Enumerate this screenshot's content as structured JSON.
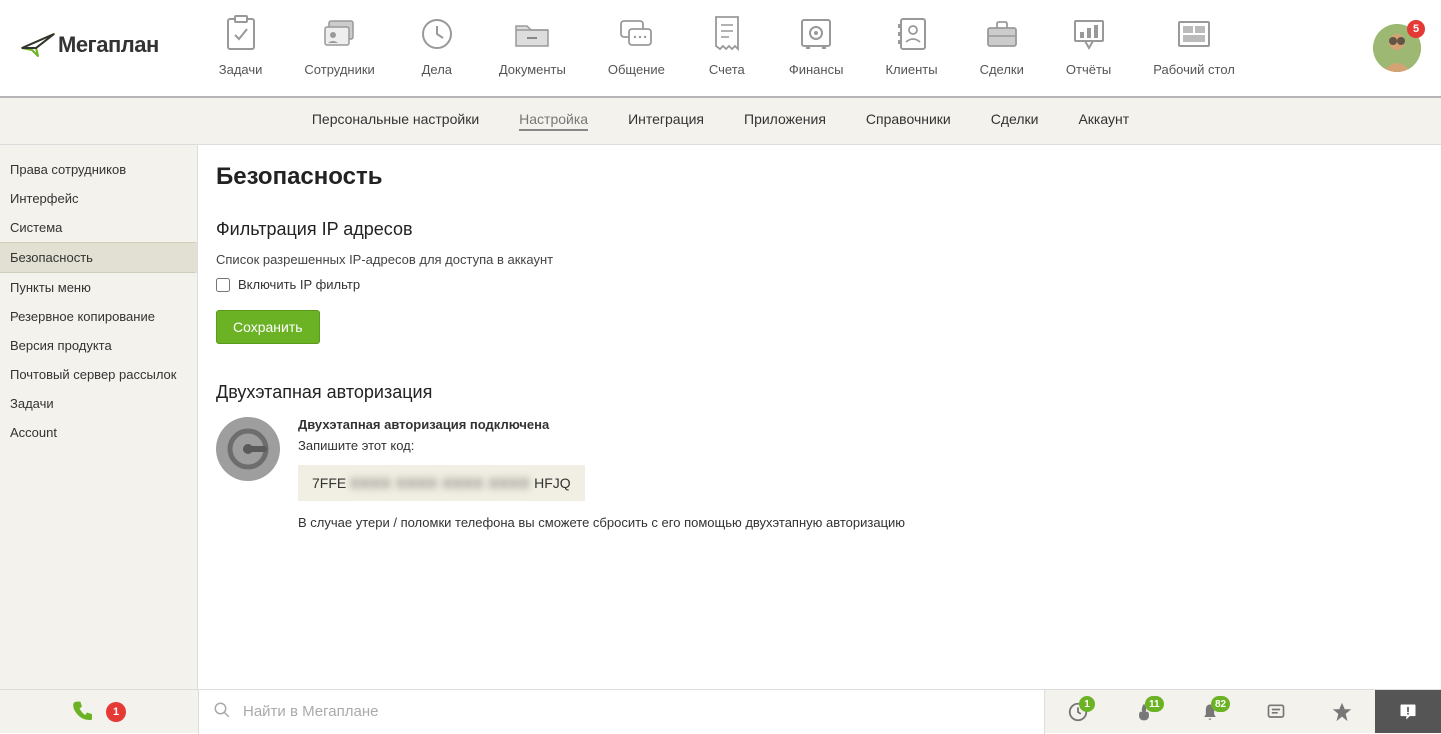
{
  "logo": {
    "text": "Мегаплан"
  },
  "topnav": [
    {
      "label": "Задачи"
    },
    {
      "label": "Сотрудники"
    },
    {
      "label": "Дела"
    },
    {
      "label": "Документы"
    },
    {
      "label": "Общение"
    },
    {
      "label": "Счета"
    },
    {
      "label": "Финансы"
    },
    {
      "label": "Клиенты"
    },
    {
      "label": "Сделки"
    },
    {
      "label": "Отчёты"
    },
    {
      "label": "Рабочий стол"
    }
  ],
  "avatar_badge": "5",
  "subnav": [
    {
      "label": "Персональные настройки"
    },
    {
      "label": "Настройка"
    },
    {
      "label": "Интеграция"
    },
    {
      "label": "Приложения"
    },
    {
      "label": "Справочники"
    },
    {
      "label": "Сделки"
    },
    {
      "label": "Аккаунт"
    }
  ],
  "sidebar": [
    "Права сотрудников",
    "Интерфейс",
    "Система",
    "Безопасность",
    "Пункты меню",
    "Резервное копирование",
    "Версия продукта",
    "Почтовый сервер рассылок",
    "Задачи",
    "Account"
  ],
  "page": {
    "title": "Безопасность",
    "ip_filter": {
      "heading": "Фильтрация IP адресов",
      "description": "Список разрешенных IP-адресов для доступа в аккаунт",
      "checkbox_label": "Включить IP фильтр",
      "save_button": "Сохранить"
    },
    "twofa": {
      "heading": "Двухэтапная авторизация",
      "status": "Двухэтапная авторизация подключена",
      "note_write": "Запишите этот код:",
      "code_prefix": "7FFE",
      "code_hidden": "XXXX XXXX XXXX XXXX",
      "code_suffix": "HFJQ",
      "recovery_note": "В случае утери / поломки телефона вы сможете сбросить с его помощью двухэтапную авторизацию"
    }
  },
  "bottombar": {
    "phone_badge": "1",
    "search_placeholder": "Найти в Мегаплане",
    "clock_badge": "1",
    "fire_badge": "11",
    "bell_badge": "82"
  }
}
